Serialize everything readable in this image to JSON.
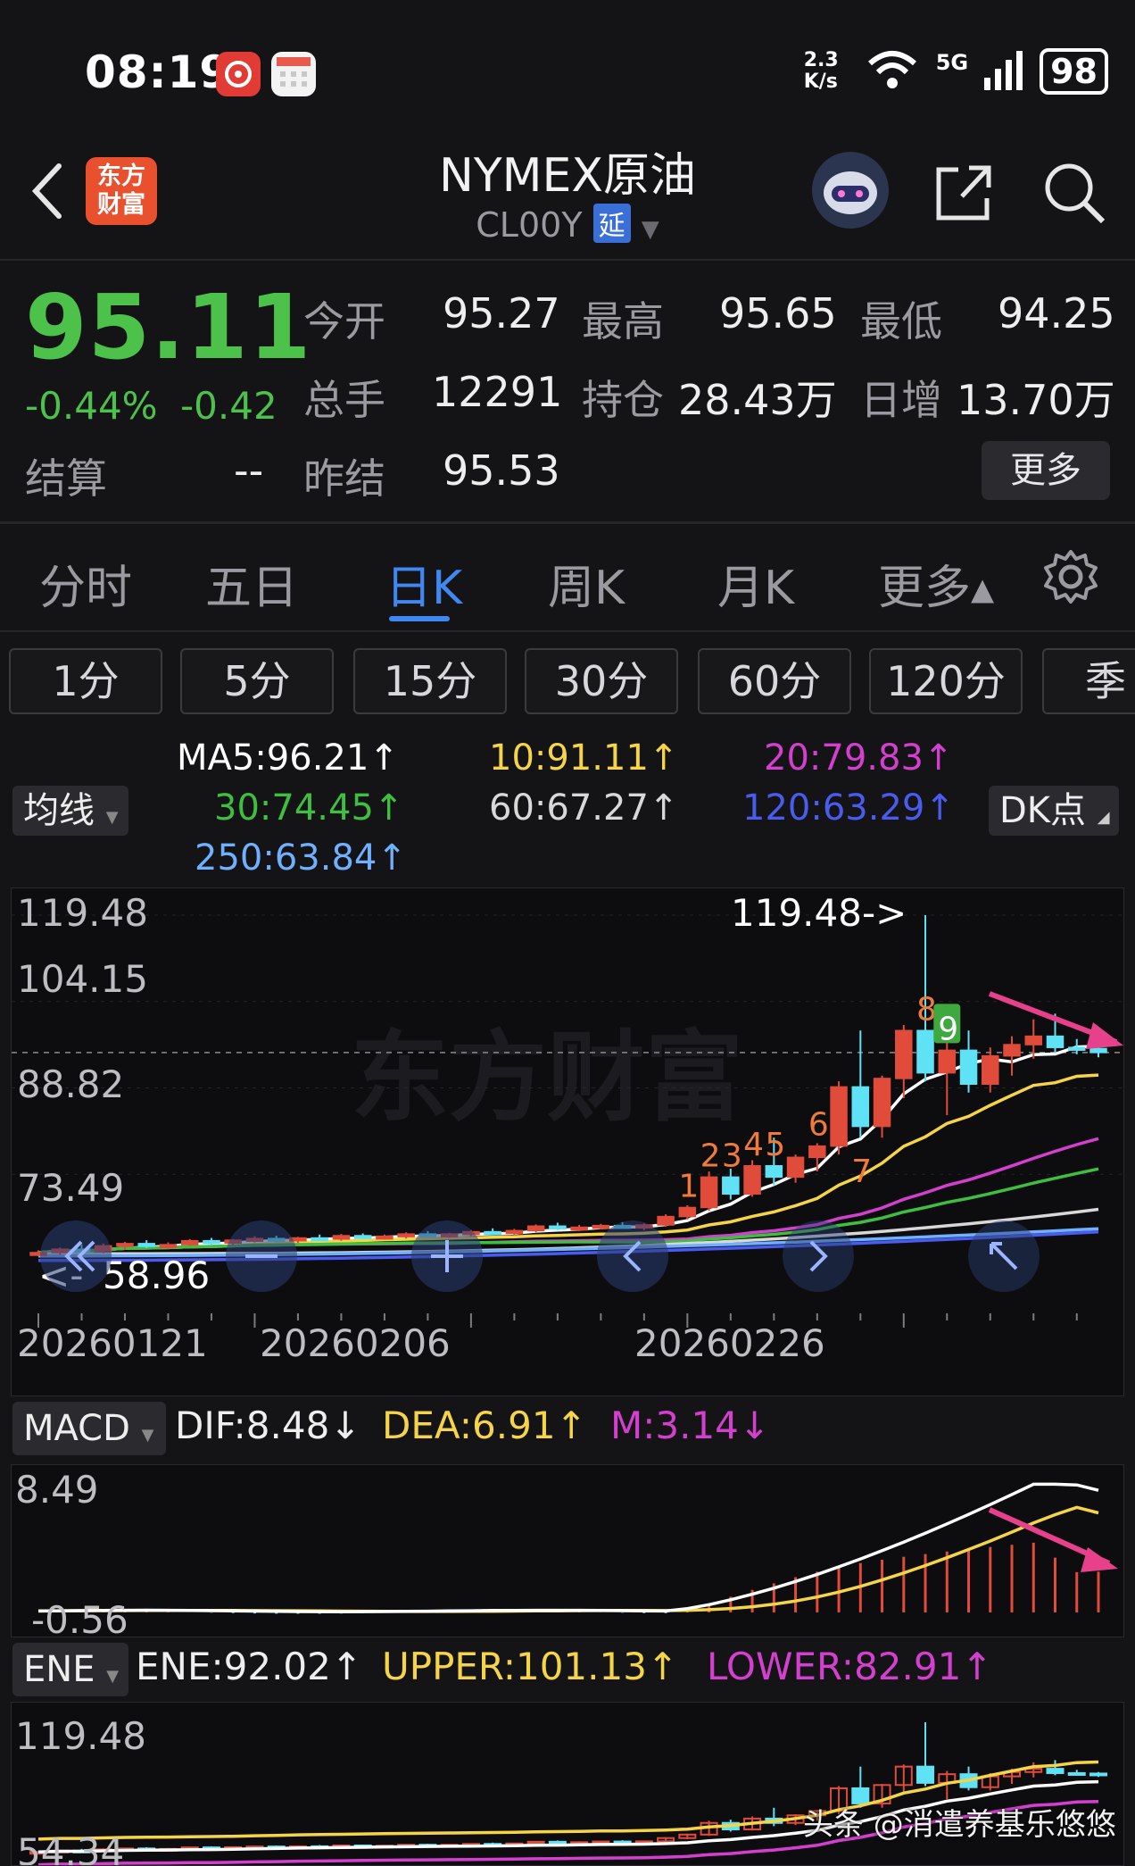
{
  "status_bar": {
    "time": "08:19",
    "net_speed": "2.3 K/s",
    "signal": "5G",
    "battery": "98",
    "icons": [
      "app-notification-icon",
      "calendar-icon",
      "wifi-icon",
      "cell-signal-icon",
      "battery-icon"
    ]
  },
  "header": {
    "back_icon": "chevron-left-icon",
    "logo_text_top": "东方",
    "logo_text_bottom": "财富",
    "title": "NYMEX原油",
    "subtitle": "CL00Y",
    "delay_tag": "延",
    "assistant_icon": "robot-avatar-icon",
    "share_icon": "share-icon",
    "search_icon": "search-icon"
  },
  "quote": {
    "price": "95.11",
    "change_pct": "-0.44%",
    "change": "-0.42",
    "open_label": "今开",
    "open": "95.27",
    "high_label": "最高",
    "high": "95.65",
    "low_label": "最低",
    "low": "94.25",
    "volume_label": "总手",
    "volume": "12291",
    "oi_label": "持仓",
    "oi": "28.43万",
    "oi_change_label": "日增",
    "oi_change": "13.70万",
    "settle_label": "结算",
    "settle": "--",
    "prev_settle_label": "昨结",
    "prev_settle": "95.53",
    "more_label": "更多",
    "colors": {
      "down": "#4cc24a",
      "up": "#f04a4a"
    }
  },
  "tabs": [
    {
      "label": "分时",
      "active": false
    },
    {
      "label": "五日",
      "active": false
    },
    {
      "label": "日K",
      "active": true
    },
    {
      "label": "周K",
      "active": false
    },
    {
      "label": "月K",
      "active": false
    },
    {
      "label": "更多▴",
      "active": false
    }
  ],
  "tabs_settings_icon": "gear-icon",
  "intervals": [
    "1分",
    "5分",
    "15分",
    "30分",
    "60分",
    "120分",
    "季"
  ],
  "ma_legend": {
    "selector": "均线",
    "ma5": "MA5:96.21↑",
    "ma10": "10:91.11↑",
    "ma20": "20:79.83↑",
    "ma30": "30:74.45↑",
    "ma60": "60:67.27↑",
    "ma120": "120:63.29↑",
    "ma250": "250:63.84↑",
    "dk_button": "DK点",
    "colors": {
      "ma5": "#ffffff",
      "ma10": "#f5d547",
      "ma20": "#d43fd0",
      "ma30": "#3fbf3f",
      "ma60": "#d8d8d8",
      "ma120": "#4a5cf0",
      "ma250": "#6fb0ff"
    }
  },
  "kline": {
    "y_ticks": [
      "119.48",
      "104.15",
      "88.82",
      "73.49"
    ],
    "low_label": "58.96",
    "low_marker": "<-",
    "high_annotation": "119.48->",
    "x_ticks": [
      "20260121",
      "20260206",
      "20260226"
    ],
    "watermark": "东方财富",
    "td_counts_up": [
      "1",
      "2",
      "3",
      "4",
      "5",
      "6",
      "8",
      "9"
    ],
    "td_count_down": "7"
  },
  "macd": {
    "selector": "MACD",
    "dif": "DIF:8.48↓",
    "dea": "DEA:6.91↑",
    "m": "M:3.14↓",
    "y_top": "8.49",
    "y_bottom": "-0.56"
  },
  "ene": {
    "selector": "ENE",
    "ene": "ENE:92.02↑",
    "upper": "UPPER:101.13↑",
    "lower": "LOWER:82.91↑",
    "y_top": "119.48",
    "y_bottom": "54.34",
    "credit": "头条 @消遣养基乐悠悠"
  },
  "chart_data": [
    {
      "type": "candlestick",
      "title": "NYMEX原油 日K",
      "x": [
        "20260121",
        "20260206",
        "20260226"
      ],
      "ylim": [
        54.34,
        119.48
      ],
      "series": [
        {
          "name": "MA5",
          "values": [
            96.21
          ]
        },
        {
          "name": "10",
          "values": [
            91.11
          ]
        },
        {
          "name": "20",
          "values": [
            79.83
          ]
        },
        {
          "name": "30",
          "values": [
            74.45
          ]
        },
        {
          "name": "60",
          "values": [
            67.27
          ]
        },
        {
          "name": "120",
          "values": [
            63.29
          ]
        },
        {
          "name": "250",
          "values": [
            63.84
          ]
        }
      ],
      "annotations": [
        "119.48->",
        "<-58.96"
      ]
    },
    {
      "type": "bar",
      "title": "MACD",
      "ylim": [
        -0.56,
        8.49
      ],
      "series": [
        {
          "name": "DIF",
          "values": [
            8.48
          ]
        },
        {
          "name": "DEA",
          "values": [
            6.91
          ]
        },
        {
          "name": "M",
          "values": [
            3.14
          ]
        }
      ]
    },
    {
      "type": "line",
      "title": "ENE",
      "ylim": [
        54.34,
        119.48
      ],
      "series": [
        {
          "name": "ENE",
          "values": [
            92.02
          ]
        },
        {
          "name": "UPPER",
          "values": [
            101.13
          ]
        },
        {
          "name": "LOWER",
          "values": [
            82.91
          ]
        }
      ]
    }
  ]
}
